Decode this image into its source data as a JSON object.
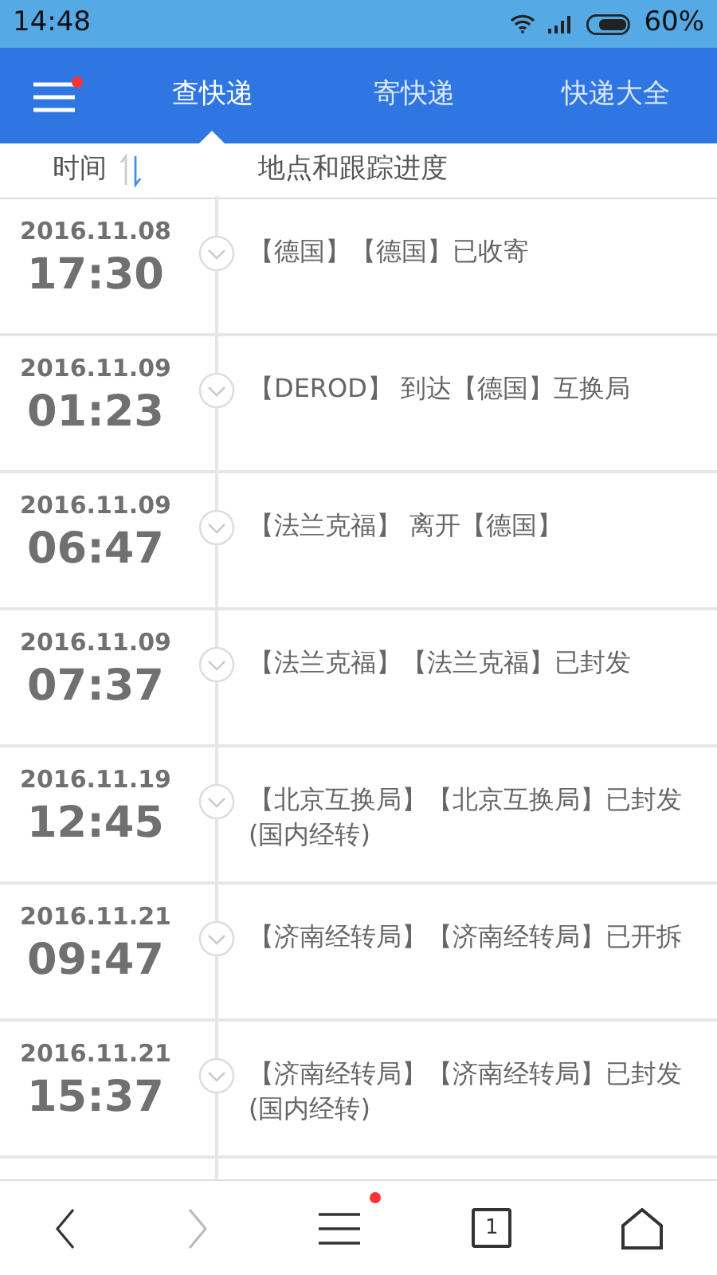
{
  "status_bar": {
    "time": "14:48",
    "battery": "60%"
  },
  "tabs": [
    {
      "label": "查快递",
      "selected": true
    },
    {
      "label": "寄快递",
      "selected": false
    },
    {
      "label": "快递大全",
      "selected": false
    }
  ],
  "menu_badge": true,
  "columns": [
    "时间",
    "地点和跟踪进度"
  ],
  "events": [
    {
      "date": "2016.11.08",
      "time": "17:30",
      "text": "【德国】【德国】已收寄"
    },
    {
      "date": "2016.11.09",
      "time": "01:23",
      "text": "【DEROD】 到达【德国】互换局"
    },
    {
      "date": "2016.11.09",
      "time": "06:47",
      "text": "【法兰克福】 离开【德国】"
    },
    {
      "date": "2016.11.09",
      "time": "07:37",
      "text": "【法兰克福】【法兰克福】已封发"
    },
    {
      "date": "2016.11.19",
      "time": "12:45",
      "text": "【北京互换局】【北京互换局】已封发(国内经转)"
    },
    {
      "date": "2016.11.21",
      "time": "09:47",
      "text": "【济南经转局】【济南经转局】已开拆"
    },
    {
      "date": "2016.11.21",
      "time": "15:37",
      "text": "【济南经转局】【济南经转局】已封发(国内经转)"
    }
  ],
  "toolbar": {
    "forward_disabled": true,
    "menu_badge": true,
    "tab_count": "1"
  }
}
